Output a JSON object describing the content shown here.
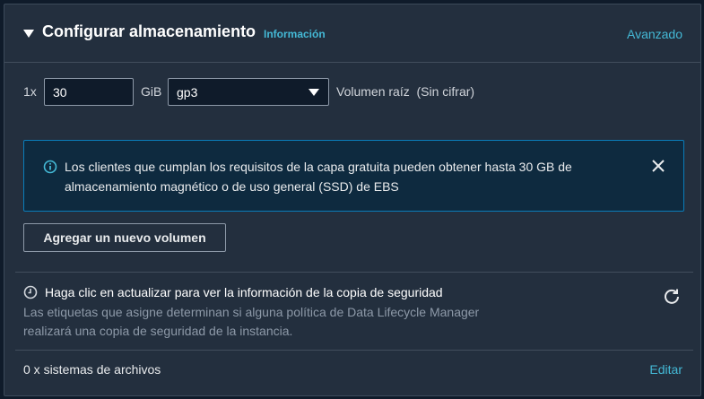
{
  "header": {
    "title": "Configurar almacenamiento",
    "info_link": "Información",
    "advanced_link": "Avanzado"
  },
  "volume": {
    "multiplier": "1x",
    "size_value": "30",
    "unit": "GiB",
    "type_selected": "gp3",
    "description": "Volumen raíz  (Sin cifrar)"
  },
  "alert": {
    "text": "Los clientes que cumplan los requisitos de la capa gratuita pueden obtener hasta 30 GB de almacenamiento magnético o de uso general (SSD) de EBS"
  },
  "add_volume_button": "Agregar un nuevo volumen",
  "backup": {
    "title": "Haga clic en actualizar para ver la información de la copia de seguridad",
    "description": "Las etiquetas que asigne determinan si alguna política de Data Lifecycle Manager realizará una copia de seguridad de la instancia."
  },
  "filesystems": {
    "count_label": "0 x sistemas de archivos",
    "edit_link": "Editar"
  },
  "colors": {
    "background": "#232f3e",
    "link": "#44b9d6",
    "alert_bg": "#0e2a3f",
    "alert_border": "#0a7dba"
  }
}
